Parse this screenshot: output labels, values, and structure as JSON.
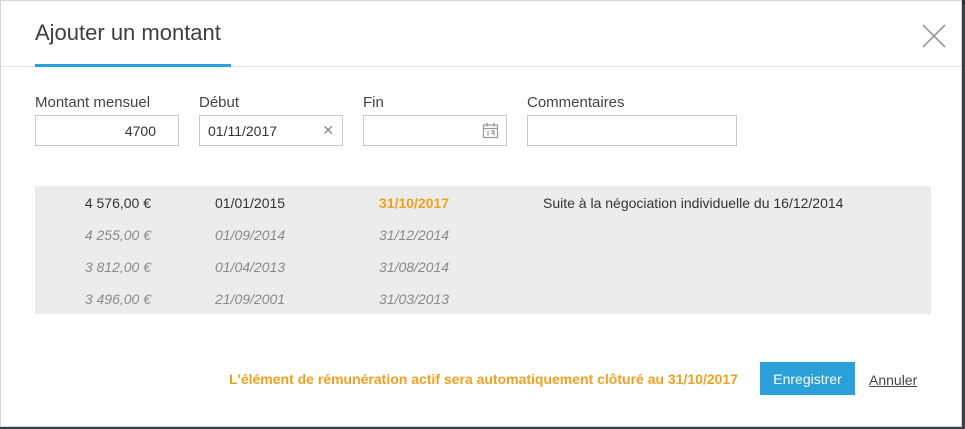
{
  "modal": {
    "title": "Ajouter un montant"
  },
  "form": {
    "montant_label": "Montant mensuel",
    "montant_value": "4700",
    "debut_label": "Début",
    "debut_value": "01/11/2017",
    "fin_label": "Fin",
    "fin_value": "",
    "commentaires_label": "Commentaires",
    "commentaires_value": ""
  },
  "history": {
    "rows": [
      {
        "amount": "4 576,00 €",
        "start": "01/01/2015",
        "end": "31/10/2017",
        "comment": "Suite à la négociation individuelle du 16/12/2014"
      },
      {
        "amount": "4 255,00 €",
        "start": "01/09/2014",
        "end": "31/12/2014",
        "comment": ""
      },
      {
        "amount": "3 812,00 €",
        "start": "01/04/2013",
        "end": "31/08/2014",
        "comment": ""
      },
      {
        "amount": "3 496,00 €",
        "start": "21/09/2001",
        "end": "31/03/2013",
        "comment": ""
      }
    ]
  },
  "footer": {
    "notice": "L'élément de rémunération actif sera automatiquement clôturé au 31/10/2017",
    "save_label": "Enregistrer",
    "cancel_label": "Annuler"
  },
  "colors": {
    "accent": "#2a9fd8",
    "warning": "#f0a020"
  },
  "icons": {
    "close": "close-icon",
    "clear": "clear-icon",
    "calendar": "calendar-icon"
  }
}
